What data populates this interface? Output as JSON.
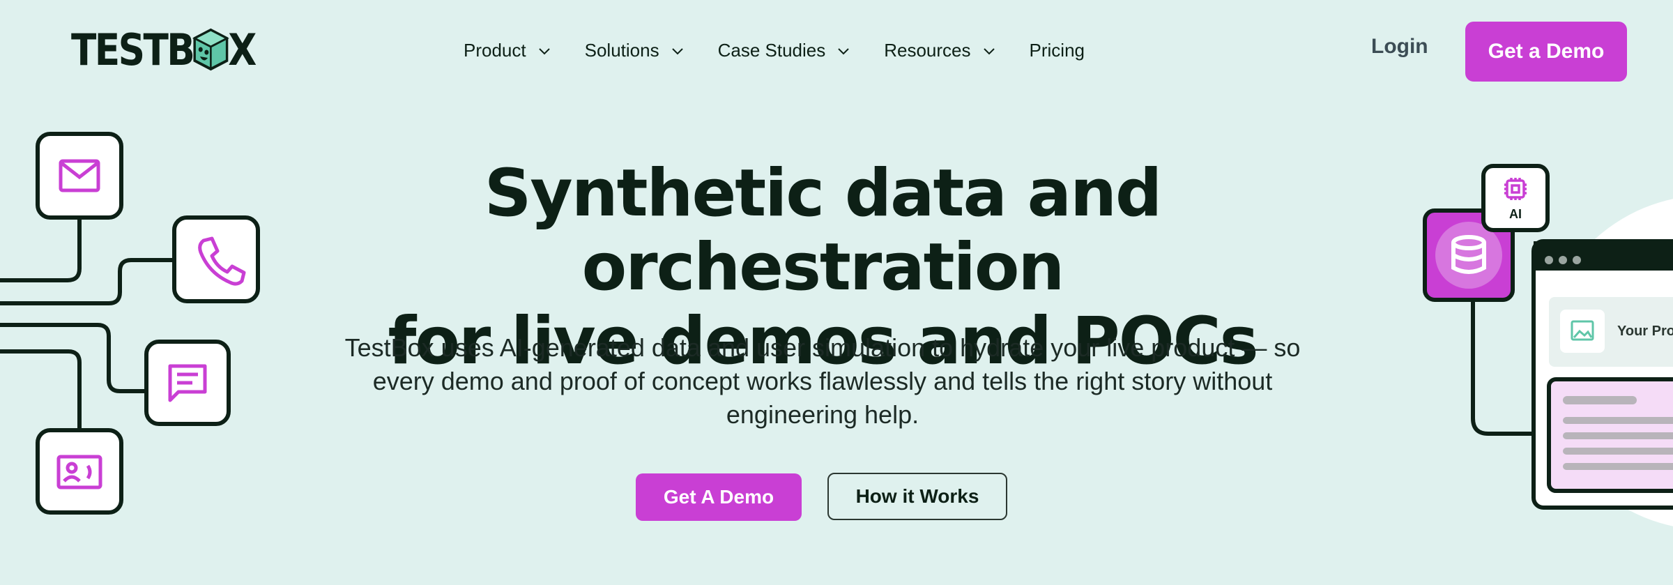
{
  "brand": {
    "logo_text_left": "TESTB",
    "logo_text_right": "X"
  },
  "nav": {
    "items": [
      {
        "label": "Product",
        "has_dropdown": true
      },
      {
        "label": "Solutions",
        "has_dropdown": true
      },
      {
        "label": "Case Studies",
        "has_dropdown": true
      },
      {
        "label": "Resources",
        "has_dropdown": true
      },
      {
        "label": "Pricing",
        "has_dropdown": false
      }
    ],
    "login_label": "Login",
    "cta_label": "Get a Demo"
  },
  "hero": {
    "headline_line1": "Synthetic data and orchestration",
    "headline_line2": "for live demos and POCs",
    "subtext": "TestBox uses AI-generated data and user simulation to hydrate your live product — so every demo and proof of concept works flawlessly and tells the right story without engineering help.",
    "primary_cta": "Get A Demo",
    "secondary_cta": "How it Works"
  },
  "right_illustration": {
    "ai_label": "AI",
    "card_label": "Your Pro"
  },
  "colors": {
    "background": "#dff1ee",
    "accent": "#c93fd4",
    "ink": "#0d2016",
    "mint": "#5fc6a8"
  },
  "icons": [
    "mail-icon",
    "phone-icon",
    "chat-icon",
    "contact-card-icon",
    "chip-icon",
    "database-icon",
    "image-icon",
    "chevron-down-icon"
  ]
}
